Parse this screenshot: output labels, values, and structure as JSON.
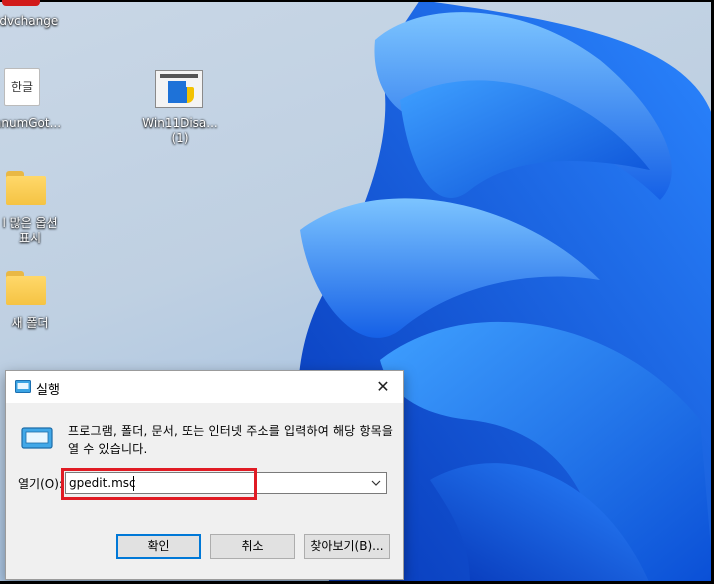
{
  "desktop": {
    "icons": [
      {
        "name": "advchange-shortcut",
        "label": "idvchange"
      },
      {
        "name": "hangul-file",
        "label": "anumGot...",
        "badge": "한글"
      },
      {
        "name": "win11-disable-file",
        "label_line1": "Win11Disa...",
        "label_line2": "(1)"
      },
      {
        "name": "folder-more-options",
        "label_line1": "l 많은 옵션",
        "label_line2": "표시"
      },
      {
        "name": "new-folder",
        "label": "새 폴더"
      }
    ]
  },
  "run_dialog": {
    "title": "실행",
    "close_glyph": "✕",
    "description": "프로그램, 폴더, 문서, 또는 인터넷 주소를 입력하여 해당 항목을 열 수 있습니다.",
    "open_label": "열기(O):",
    "open_value": "gpedit.msc",
    "buttons": {
      "ok": "확인",
      "cancel": "취소",
      "browse": "찾아보기(B)..."
    }
  },
  "colors": {
    "highlight": "#e01b24",
    "accent": "#0078d7",
    "wallpaper_blue": "#1466e8"
  }
}
